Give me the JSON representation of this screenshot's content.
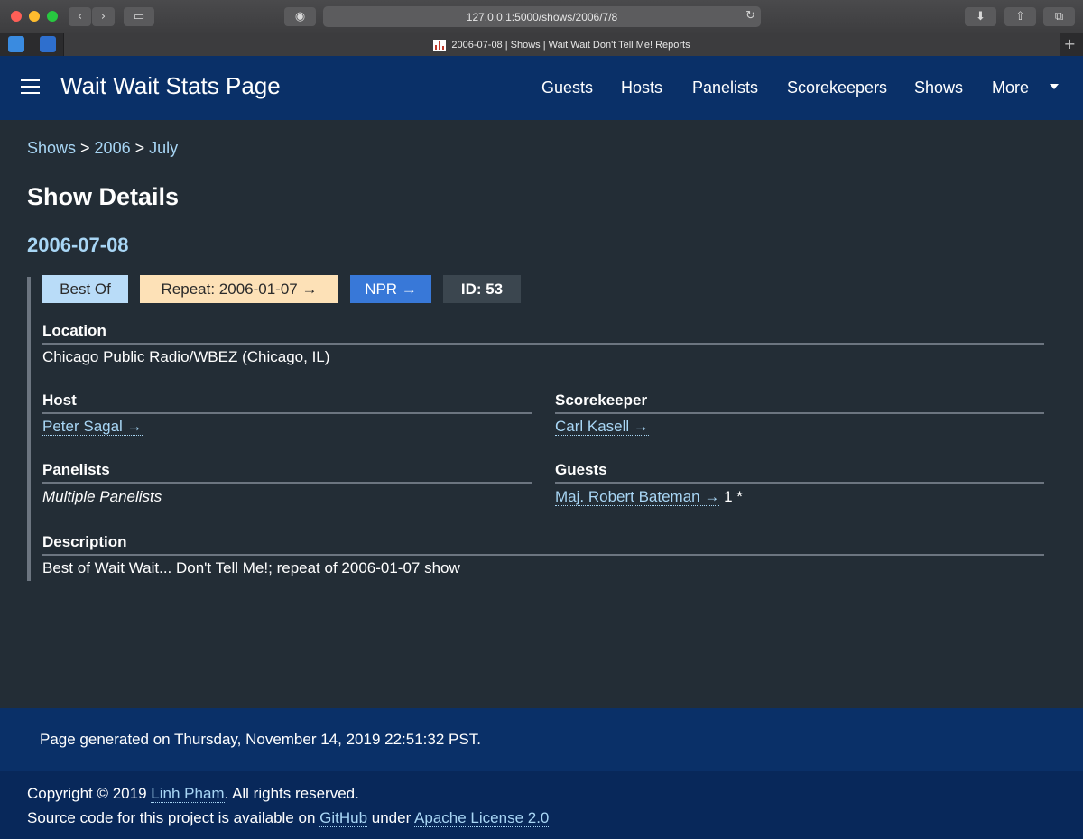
{
  "browser": {
    "url": "127.0.0.1:5000/shows/2006/7/8",
    "tab_title": "2006-07-08 | Shows | Wait Wait Don't Tell Me! Reports",
    "icons": [
      "back-icon",
      "forward-icon",
      "sidebar-icon",
      "reader-icon",
      "reload-icon",
      "download-icon",
      "share-icon",
      "tabs-icon",
      "new-tab-icon"
    ]
  },
  "navbar": {
    "title": "Wait Wait Stats Page",
    "items": [
      "Guests",
      "Hosts",
      "Panelists",
      "Scorekeepers",
      "Shows",
      "More"
    ]
  },
  "breadcrumb": {
    "shows": "Shows",
    "sep1": " > ",
    "year": "2006",
    "sep2": " > ",
    "month": "July"
  },
  "page": {
    "heading": "Show Details",
    "date": "2006-07-08"
  },
  "tags": {
    "best_of": "Best Of",
    "repeat": "Repeat: 2006-01-07 →",
    "npr": "NPR →",
    "id": "ID: 53"
  },
  "details": {
    "location_label": "Location",
    "location_value": "Chicago Public Radio/WBEZ (Chicago, IL)",
    "host_label": "Host",
    "host_value": "Peter Sagal →",
    "scorekeeper_label": "Scorekeeper",
    "scorekeeper_value": "Carl Kasell →",
    "panelists_label": "Panelists",
    "panelists_value": "Multiple Panelists",
    "guests_label": "Guests",
    "guest_name": "Maj. Robert Bateman →",
    "guest_score": " 1 *",
    "description_label": "Description",
    "description_value": "Best of Wait Wait... Don't Tell Me!; repeat of 2006-01-07 show"
  },
  "footer": {
    "generated": "Page generated on Thursday, November 14, 2019 22:51:32 PST.",
    "copyright_prefix": "Copyright © 2019 ",
    "author": "Linh Pham",
    "copyright_suffix": ". All rights reserved.",
    "source_prefix": "Source code for this project is available on ",
    "github": "GitHub",
    "source_mid": " under ",
    "license": "Apache License 2.0"
  },
  "colors": {
    "navbar_bg": "#0a3068",
    "page_bg": "#232d36",
    "link": "#a8d6f5",
    "best_of_tag": "#b9dcf8",
    "repeat_tag": "#fde1b7",
    "npr_tag": "#3878d8",
    "id_tag": "#3b464f"
  }
}
